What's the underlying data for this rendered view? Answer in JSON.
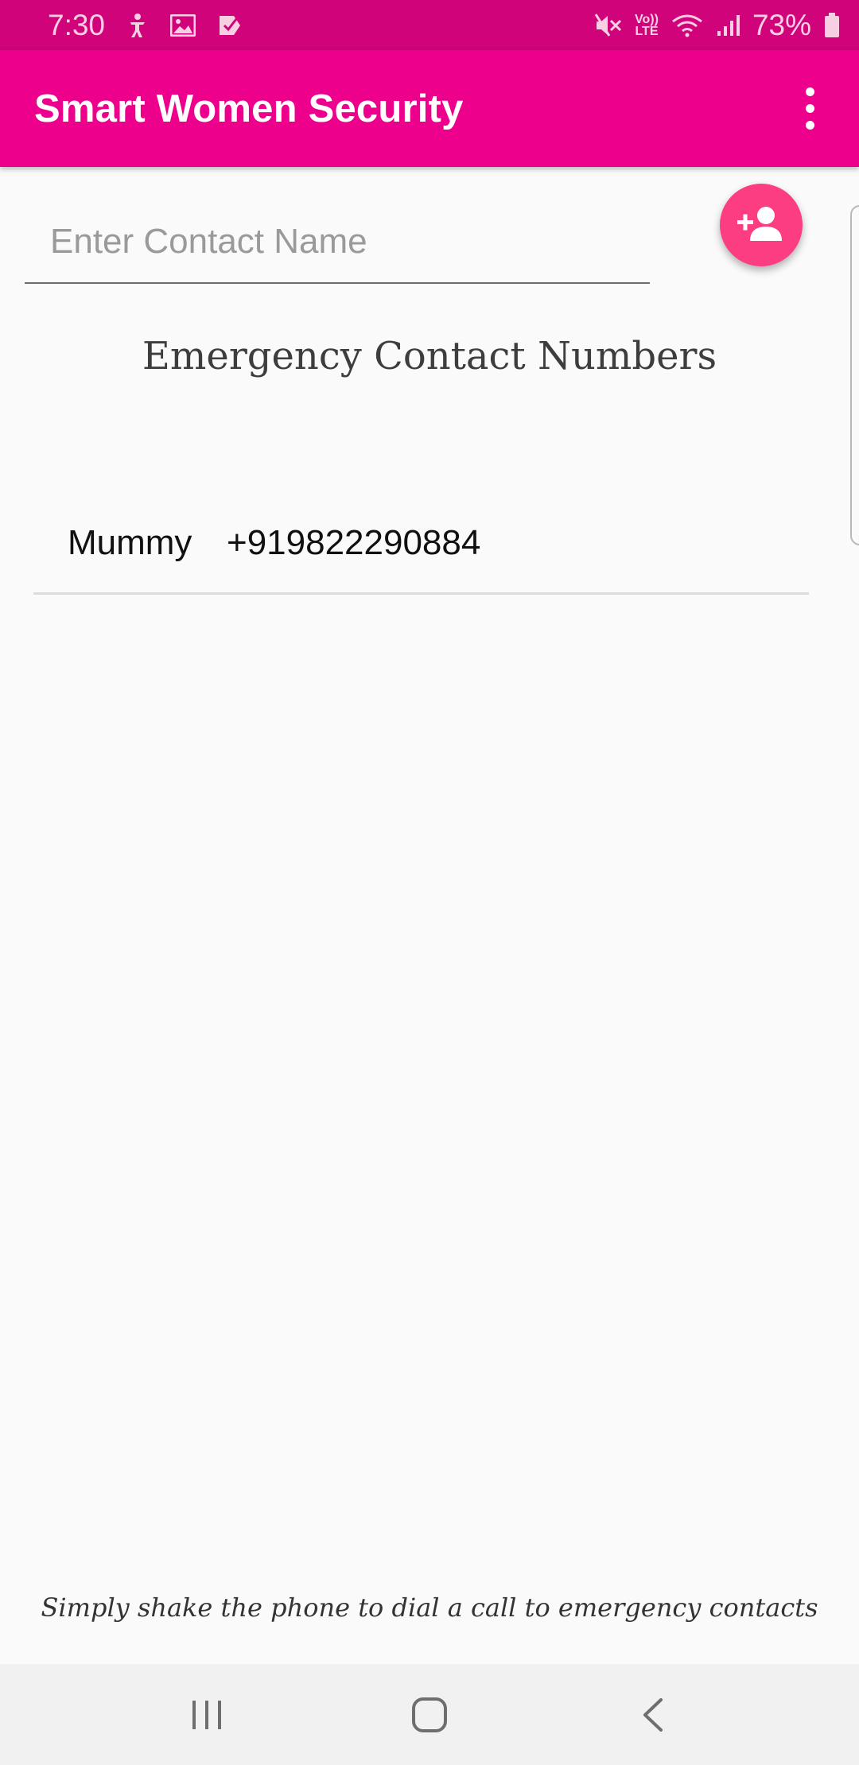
{
  "status_bar": {
    "time": "7:30",
    "battery": "73%",
    "volte_line1": "Vo))",
    "volte_line2": "LTE",
    "icons": [
      "accessibility-icon",
      "gallery-icon",
      "check-app-icon",
      "mute-icon",
      "volte-icon",
      "wifi-icon",
      "signal-icon",
      "battery-icon"
    ]
  },
  "app_bar": {
    "title": "Smart Women Security",
    "background": "#ec008c",
    "overflow_icon": "more-vert-icon"
  },
  "contact_form": {
    "input_placeholder": "Enter Contact Name",
    "input_value": "",
    "add_button_icon": "person-add-icon",
    "add_button_color": "#fc3d82"
  },
  "section": {
    "heading": "Emergency Contact Numbers"
  },
  "contacts": [
    {
      "name": "Mummy",
      "number": "+919822290884"
    }
  ],
  "footer": {
    "hint": "Simply shake the phone to dial a call to emergency contacts"
  },
  "nav_bar": {
    "icons": [
      "recent-apps-icon",
      "home-icon",
      "back-icon"
    ]
  }
}
